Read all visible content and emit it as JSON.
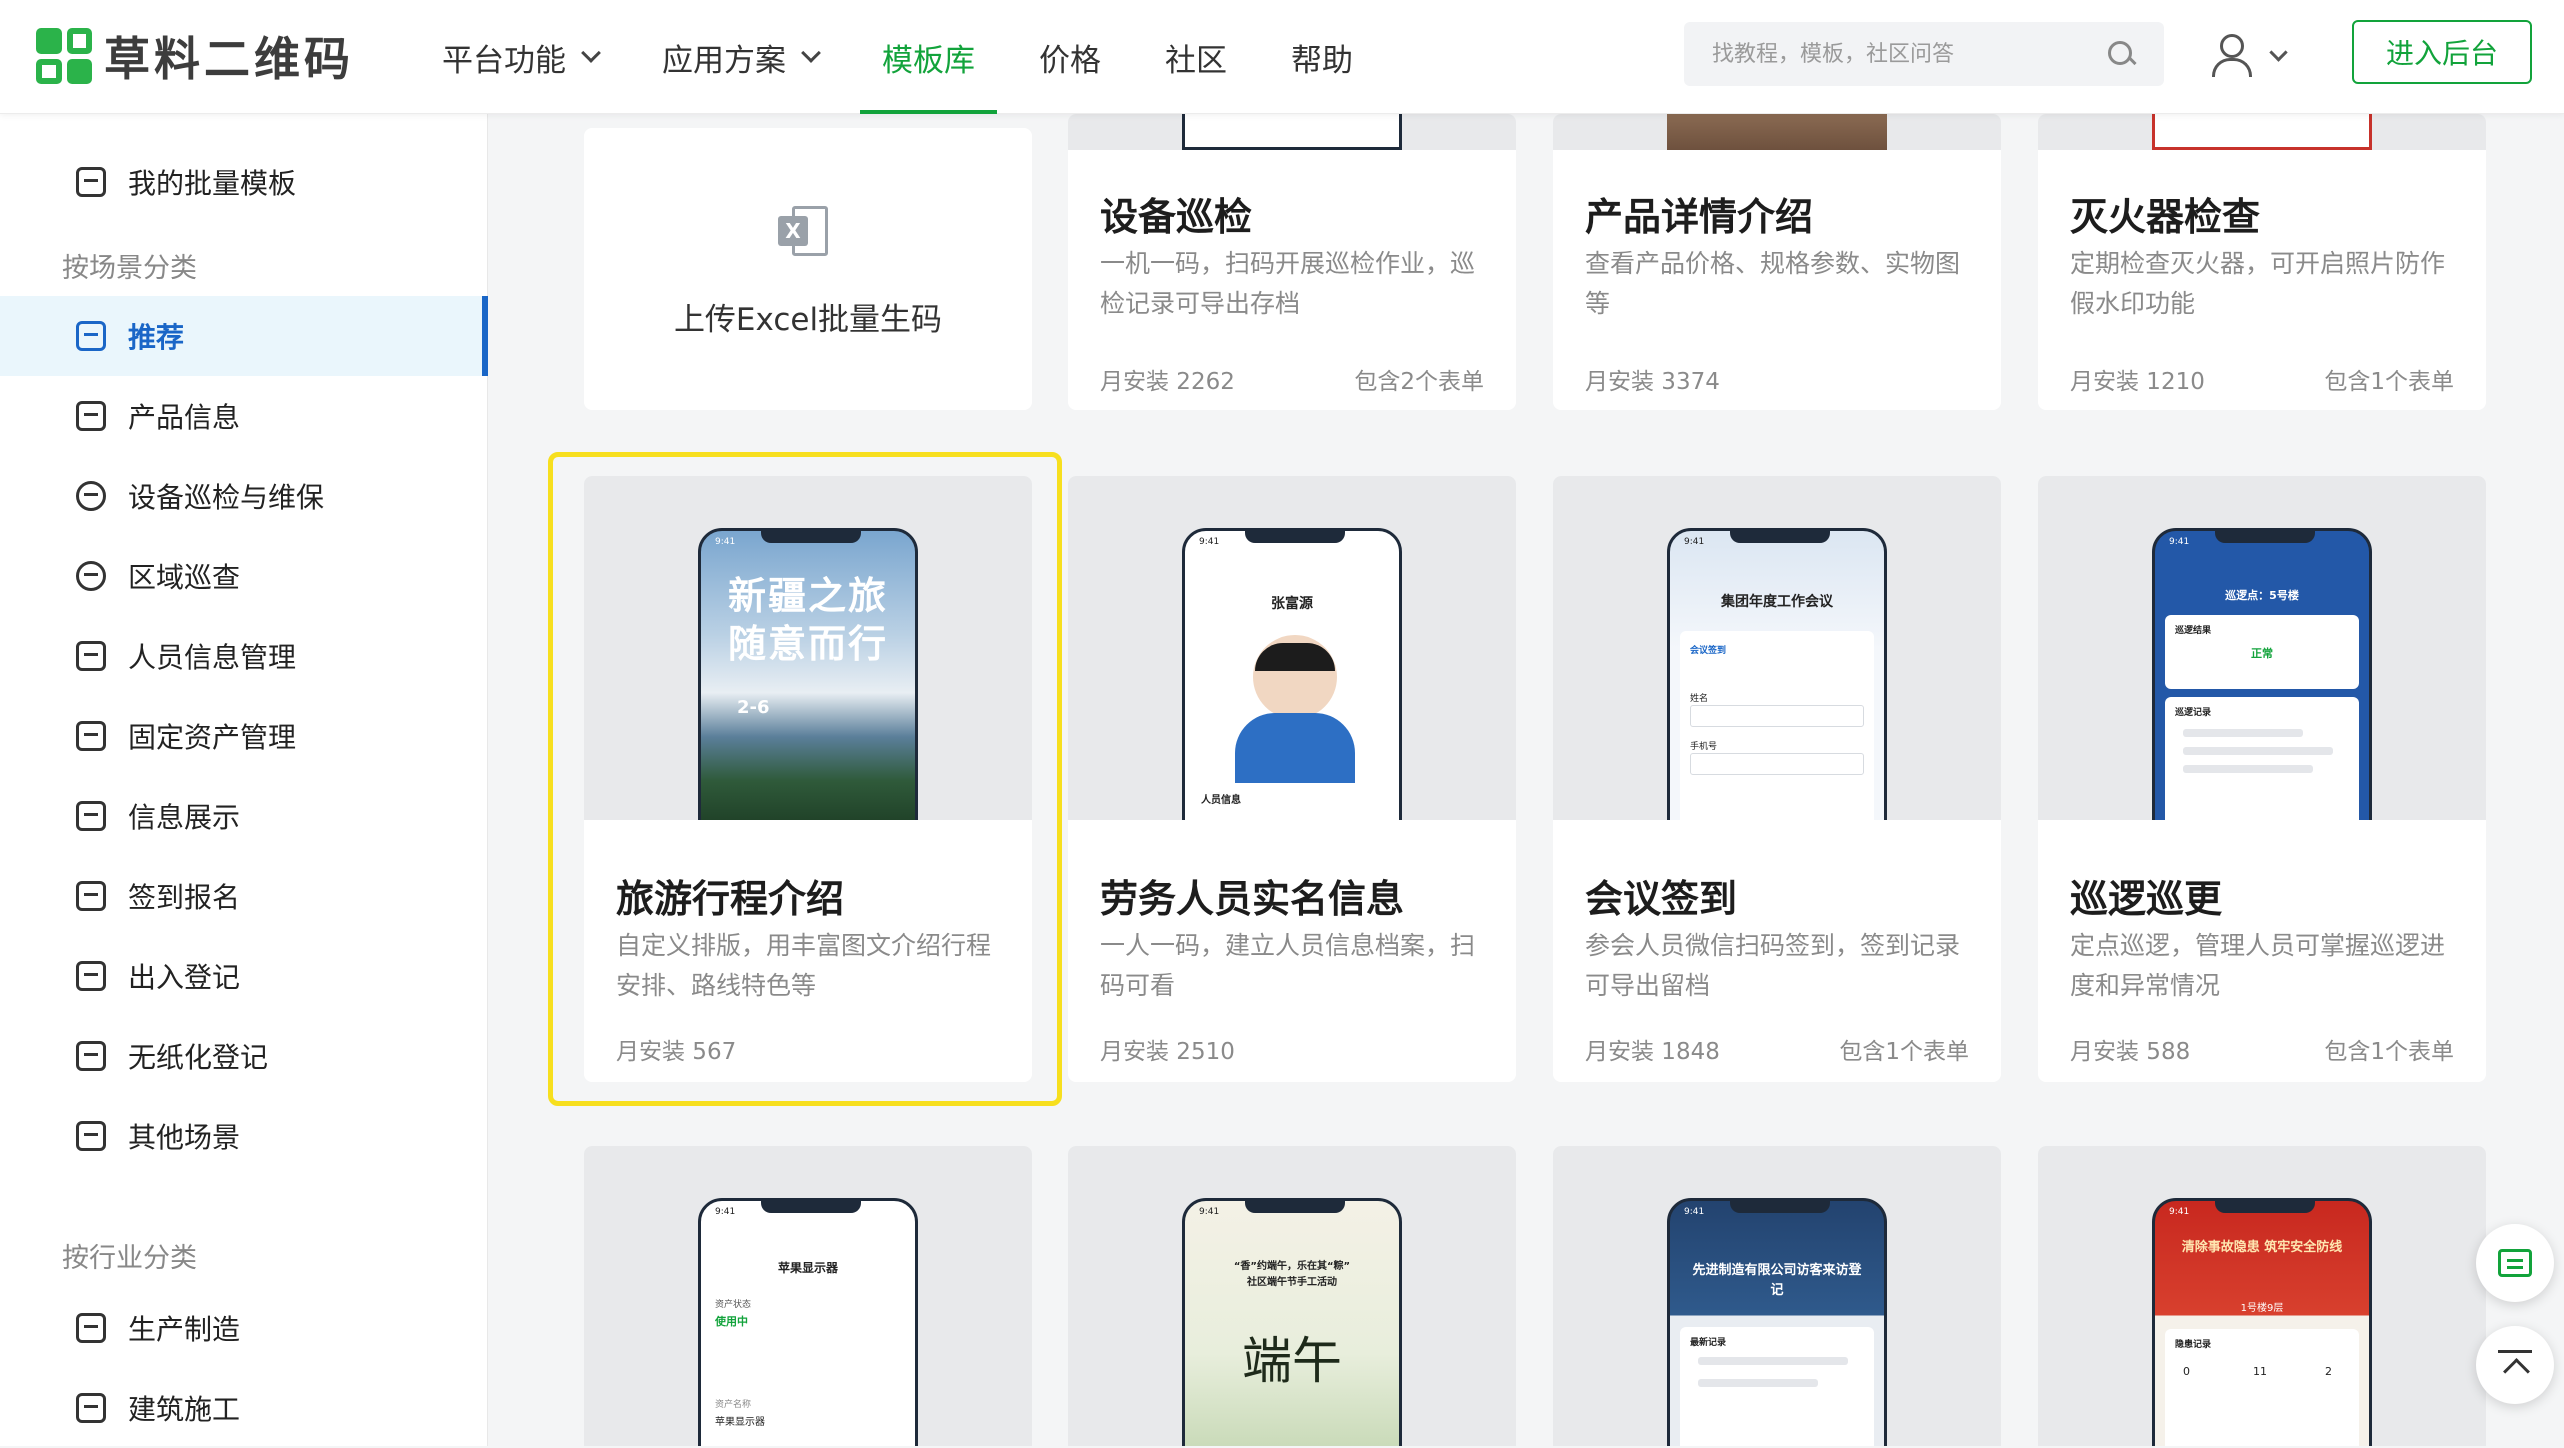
{
  "header": {
    "logo_text": "草料二维码",
    "nav": [
      {
        "label": "平台功能",
        "dropdown": true,
        "active": false
      },
      {
        "label": "应用方案",
        "dropdown": true,
        "active": false
      },
      {
        "label": "模板库",
        "dropdown": false,
        "active": true
      },
      {
        "label": "价格",
        "dropdown": false,
        "active": false
      },
      {
        "label": "社区",
        "dropdown": false,
        "active": false
      },
      {
        "label": "帮助",
        "dropdown": false,
        "active": false
      }
    ],
    "search_placeholder": "找教程，模板，社区问答",
    "enter_button": "进入后台",
    "accent_color": "#12a33b"
  },
  "sidebar": {
    "my_templates": "我的批量模板",
    "group_scene": "按场景分类",
    "scene_items": [
      {
        "label": "推荐",
        "active": true
      },
      {
        "label": "产品信息"
      },
      {
        "label": "设备巡检与维保"
      },
      {
        "label": "区域巡查"
      },
      {
        "label": "人员信息管理"
      },
      {
        "label": "固定资产管理"
      },
      {
        "label": "信息展示"
      },
      {
        "label": "签到报名"
      },
      {
        "label": "出入登记"
      },
      {
        "label": "无纸化登记"
      },
      {
        "label": "其他场景"
      }
    ],
    "group_industry": "按行业分类",
    "industry_items": [
      {
        "label": "生产制造"
      },
      {
        "label": "建筑施工"
      }
    ],
    "active_color": "#1a66c7"
  },
  "upload": {
    "label": "上传Excel批量生码",
    "icon": "excel-icon"
  },
  "cards_row1": [
    {
      "title": "设备巡检",
      "desc": "一机一码，扫码开展巡检作业，巡检记录可导出存档",
      "installs": "月安装 2262",
      "forms": "包含2个表单"
    },
    {
      "title": "产品详情介绍",
      "desc": "查看产品价格、规格参数、实物图等",
      "installs": "月安装 3374",
      "forms": ""
    },
    {
      "title": "灭火器检查",
      "desc": "定期检查灭火器，可开启照片防作假水印功能",
      "installs": "月安装 1210",
      "forms": "包含1个表单"
    }
  ],
  "cards_row2": [
    {
      "title": "旅游行程介绍",
      "desc": "自定义排版，用丰富图文介绍行程安排、路线特色等",
      "installs": "月安装 567",
      "forms": "",
      "preview": {
        "headline1": "新疆之旅",
        "headline2": "随意而行",
        "date": "2-6"
      }
    },
    {
      "title": "劳务人员实名信息",
      "desc": "一人一码，建立人员信息档案，扫码可看",
      "installs": "月安装 2510",
      "forms": "",
      "preview": {
        "name": "张富源",
        "footer": "人员信息"
      }
    },
    {
      "title": "会议签到",
      "desc": "参会人员微信扫码签到，签到记录可导出留档",
      "installs": "月安装 1848",
      "forms": "包含1个表单",
      "preview": {
        "heading": "集团年度工作会议",
        "sub": "会议签到",
        "field1": "姓名",
        "field2": "手机号"
      }
    },
    {
      "title": "巡逻巡更",
      "desc": "定点巡逻，管理人员可掌握巡逻进度和异常情况",
      "installs": "月安装 588",
      "forms": "包含1个表单",
      "preview": {
        "heading": "巡逻点：5号楼",
        "result_label": "巡逻结果",
        "result": "正常",
        "record_label": "巡逻记录"
      }
    }
  ],
  "cards_row3": [
    {
      "preview": {
        "heading": "苹果显示器",
        "status_label": "资产状态",
        "status": "使用中",
        "name_label": "资产名称",
        "name": "苹果显示器"
      }
    },
    {
      "preview": {
        "heading": "“香”约端午，乐在其“粽”",
        "sub": "社区端午节手工活动",
        "art": "端午"
      }
    },
    {
      "preview": {
        "heading": "先进制造有限公司访客来访登记",
        "record_label": "最新记录"
      }
    },
    {
      "preview": {
        "heading": "清除事故隐患 筑牢安全防线",
        "sub": "1号楼9层",
        "record_label": "隐患记录",
        "n1": "0",
        "n2": "11",
        "n3": "2"
      }
    }
  ],
  "phone_time": "9:41"
}
